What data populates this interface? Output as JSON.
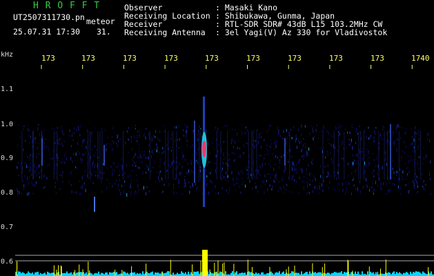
{
  "header": {
    "app_name": "H R O F F T",
    "filename": "UT2507311730.pn",
    "meteor_label": "meteor",
    "date_time": "25.07.31 17:30",
    "count": "31.",
    "observer_label": "Observer",
    "observer_value": ": Masaki Kano",
    "location_label": "Receiving Location",
    "location_value": ": Shibukawa, Gunma, Japan",
    "receiver_label": "Receiver",
    "receiver_value": ": RTL-SDR SDR# 43dB L15 103.2MHz CW",
    "antenna_label": "Receiving Antenna",
    "antenna_value": ": 3el Yagi(V) Az 330 for Vladivostok"
  },
  "axis": {
    "unit": "kHz",
    "y_ticks": [
      "1.1",
      "1.0",
      "0.9",
      "0.8",
      "0.7",
      "0.6"
    ],
    "time_ticks": [
      "173",
      "173",
      "173",
      "173",
      "173",
      "173",
      "173",
      "173",
      "173",
      "1740"
    ]
  },
  "colors": {
    "header_green": "#33cc44",
    "tick_yellow": "#ffff66",
    "background": "#000000",
    "signal_low": "#1a1a8c",
    "signal_high": "#ff3366",
    "spectrum_yellow": "#ffff00",
    "spectrum_cyan": "#00d8ff"
  }
}
